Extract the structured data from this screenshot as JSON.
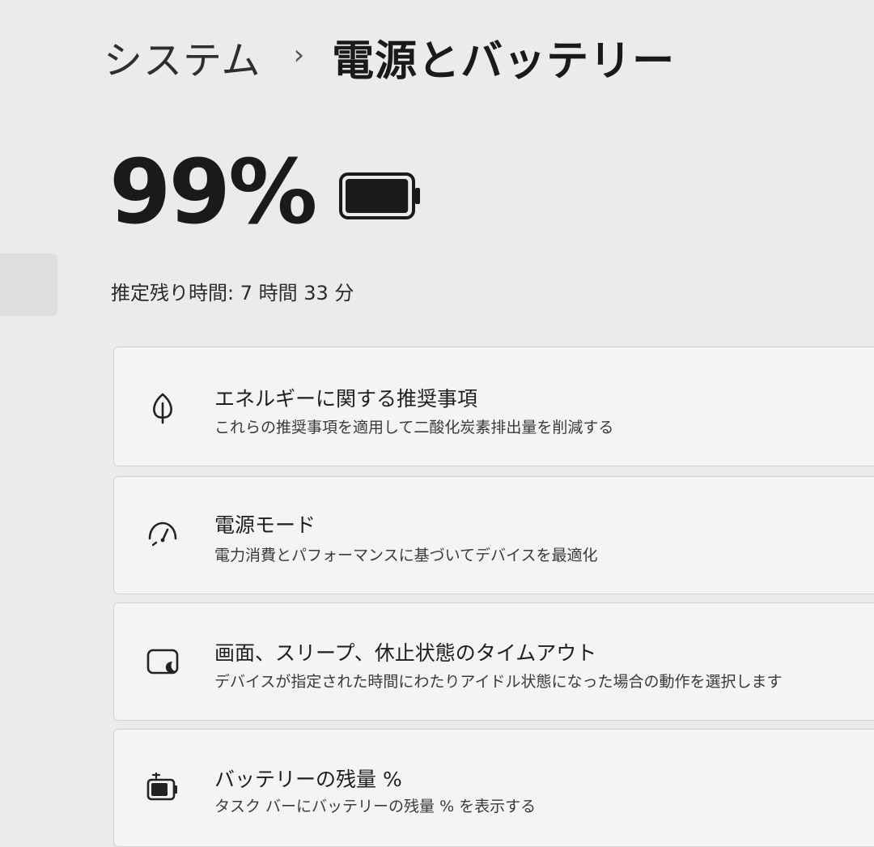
{
  "breadcrumb": {
    "parent": "システム",
    "separator": "›",
    "current": "電源とバッテリー"
  },
  "battery": {
    "percent_text": "99%",
    "level": 0.99,
    "icon": "battery-icon"
  },
  "remaining": {
    "label": "推定残り時間: 7 時間 33 分"
  },
  "cards": [
    {
      "icon": "leaf-icon",
      "title": "エネルギーに関する推奨事項",
      "description": "これらの推奨事項を適用して二酸化炭素排出量を削減する"
    },
    {
      "icon": "gauge-icon",
      "title": "電源モード",
      "description": "電力消費とパフォーマンスに基づいてデバイスを最適化"
    },
    {
      "icon": "display-sleep-icon",
      "title": "画面、スリープ、休止状態のタイムアウト",
      "description": "デバイスが指定された時間にわたりアイドル状態になった場合の動作を選択します"
    },
    {
      "icon": "battery-percentage-icon",
      "title": "バッテリーの残量 %",
      "description": "タスク バーにバッテリーの残量 % を表示する"
    }
  ]
}
